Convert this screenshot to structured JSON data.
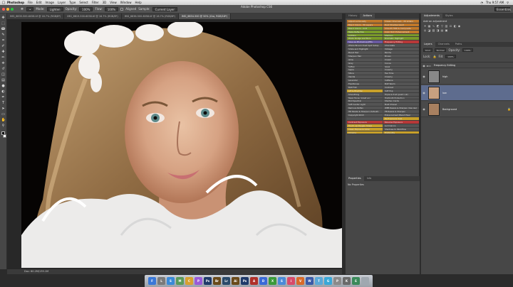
{
  "menubar": {
    "apple": "",
    "app": "Photoshop",
    "items": [
      "File",
      "Edit",
      "Image",
      "Layer",
      "Type",
      "Select",
      "Filter",
      "3D",
      "View",
      "Window",
      "Help"
    ],
    "clock": "Thu 9:57 AM"
  },
  "window_title": "Adobe Photoshop CS6",
  "options": {
    "mode_label": "Mode:",
    "mode_value": "Lighten",
    "opacity_label": "Opacity:",
    "opacity_value": "100%",
    "flow_label": "Flow:",
    "flow_value": "100%",
    "aligned_label": "Aligned",
    "sample_label": "Sample:",
    "sample_value": "Current Layer",
    "workspace": "Essentials"
  },
  "doc_tabs": [
    "IMG_6835-500-6058.tif @ 16.7% (RGB/8*)",
    "IMG_6819-500-6058.tif @ 16.7% (RGB/8*)",
    "IMG_6836-500-6058.tif @ 16.7% (RGB/8*)",
    "IMG_6834-500 @ 50% (Gra, RGB/16*)"
  ],
  "status": "Doc: 60.2M/139.1M",
  "actions_panel": {
    "tab_history": "History",
    "tab_actions": "Actions",
    "items_left": [
      {
        "label": "Adjust Luminosity",
        "color": "#c0782a"
      },
      {
        "label": "Blend Colors - 50 Layers",
        "color": "#c0782a"
      },
      {
        "label": "Blend Colors - Grid",
        "color": "#7a9a2a"
      },
      {
        "label": "Make Reflection",
        "color": "#7a9a2a"
      },
      {
        "label": "Lighten",
        "color": "#7a9a2a"
      },
      {
        "label": "Photo Dodge and Burn",
        "color": "#7a9a2a"
      },
      {
        "label": "Save as Photoshop JPEG",
        "color": "#6a5aa0"
      },
      {
        "label": "Whole Broom Dust Spot Setup",
        "color": "#545454"
      },
      {
        "label": "Smile and Highlight",
        "color": "#545454"
      },
      {
        "label": "Boost Hair",
        "color": "#545454"
      },
      {
        "label": "Sharpen Hair",
        "color": "#545454"
      },
      {
        "label": "Glow",
        "color": "#545454"
      },
      {
        "label": "Grey",
        "color": "#545454"
      },
      {
        "label": "Soften",
        "color": "#545454"
      },
      {
        "label": "Sepia",
        "color": "#545454"
      },
      {
        "label": "Shine",
        "color": "#545454"
      },
      {
        "label": "Vanilla",
        "color": "#545454"
      },
      {
        "label": "Lavender",
        "color": "#545454"
      },
      {
        "label": "Fleshtones",
        "color": "#545454"
      },
      {
        "label": "B/W Film",
        "color": "#545454"
      },
      {
        "label": "Lift & Brighten",
        "color": "#c8a02a"
      },
      {
        "label": "Smoothing",
        "color": "#545454"
      },
      {
        "label": "Mask Faces (great eo)",
        "color": "#545454"
      },
      {
        "label": "Bird Spectral",
        "color": "#545454"
      },
      {
        "label": "Soft Center Light",
        "color": "#545454"
      },
      {
        "label": "Remove Reflex",
        "color": "#545454"
      },
      {
        "label": "HR Resize & Sharpen (default)",
        "color": "#545454"
      },
      {
        "label": "Copyright 2013",
        "color": "#545454"
      },
      {
        "label": "",
        "color": "#545454"
      },
      {
        "label": "Contrast Exposure",
        "color": "#b83838"
      },
      {
        "label": "Touch up Oxygen Sharp",
        "color": "#c8a02a"
      },
      {
        "label": "Clean Exposure Glow",
        "color": "#c8a02a"
      },
      {
        "label": "Chroma",
        "color": "#c8a02a"
      }
    ],
    "items_right": [
      {
        "label": "Classic Channels - 20 sliders",
        "color": "#c0782a"
      },
      {
        "label": "Dark Shadow Good",
        "color": "#c0782a"
      },
      {
        "label": "Smooth HDR & Composite",
        "color": "#c0782a"
      },
      {
        "label": "Color Rich Enhancement",
        "color": "#c0782a"
      },
      {
        "label": "Sharpen",
        "color": "#7a9a2a"
      },
      {
        "label": "Dramatic Highlight",
        "color": "#7a9a2a"
      },
      {
        "label": "Frequency Editing",
        "color": "#b83838"
      },
      {
        "label": "Chocolate",
        "color": "#545454"
      },
      {
        "label": "Vintage",
        "color": "#545454"
      },
      {
        "label": "Mocha",
        "color": "#545454"
      },
      {
        "label": "Brown",
        "color": "#545454"
      },
      {
        "label": "Cream",
        "color": "#545454"
      },
      {
        "label": "Cocoa",
        "color": "#545454"
      },
      {
        "label": "Jewel",
        "color": "#545454"
      },
      {
        "label": "Creamy",
        "color": "#545454"
      },
      {
        "label": "Tea Time",
        "color": "#545454"
      },
      {
        "label": "Creamy",
        "color": "#545454"
      },
      {
        "label": "Caffeine",
        "color": "#545454"
      },
      {
        "label": "B/W Warm",
        "color": "#545454"
      },
      {
        "label": "Contrast",
        "color": "#545454"
      },
      {
        "label": "Soft Pop",
        "color": "#545454"
      },
      {
        "label": "Triple & fruit (paint cut)",
        "color": "#545454"
      },
      {
        "label": "Highlight Protection",
        "color": "#545454"
      },
      {
        "label": "Shorten Cords",
        "color": "#545454"
      },
      {
        "label": "Bust Chanel",
        "color": "#545454"
      },
      {
        "label": "WEB Resize & Sharpen (low res)",
        "color": "#545454"
      },
      {
        "label": "FB Resize & Sharpen",
        "color": "#545454"
      },
      {
        "label": "Enhancement Blend Pixel",
        "color": "#545454"
      },
      {
        "label": "Re Exposure Seal",
        "color": "#c8a02a"
      },
      {
        "label": "Reverse Exposure",
        "color": "#b83838"
      },
      {
        "label": "Luminance",
        "color": "#545454"
      },
      {
        "label": "Shadows to Workflow",
        "color": "#545454"
      },
      {
        "label": "Highlights",
        "color": "#c8a02a"
      }
    ]
  },
  "properties": {
    "tab_properties": "Properties",
    "tab_info": "Info",
    "title": "No Properties"
  },
  "right_panel": {
    "tab_adjustments": "Adjustments",
    "tab_styles": "Styles",
    "adj_title": "Add an adjustment",
    "tab_layers": "Layers",
    "tab_channels": "Channels",
    "tab_paths": "Paths",
    "kind_label": "Kind",
    "blend_mode": "Normal",
    "opacity_label": "Opacity:",
    "opacity_value": "100%",
    "lock_label": "Lock:",
    "fill_label": "Fill:",
    "fill_value": "100%",
    "group_name": "Frequency Editing",
    "layers": [
      {
        "name": "high",
        "thumb": "#808080",
        "selected": false
      },
      {
        "name": "low",
        "thumb": "#c8a080",
        "selected": true
      },
      {
        "name": "Background",
        "thumb": "#a88060",
        "selected": false
      }
    ]
  },
  "dock": {
    "icons": [
      {
        "label": "F",
        "color": "#3a78d8"
      },
      {
        "label": "L",
        "color": "#7a7a7a"
      },
      {
        "label": "S",
        "color": "#3a8ad8"
      },
      {
        "label": "M",
        "color": "#5a9a5a"
      },
      {
        "label": "C",
        "color": "#d8a030"
      },
      {
        "label": "P",
        "color": "#9a5ad8"
      },
      {
        "label": "Ps",
        "color": "#1f3a6a"
      },
      {
        "label": "Br",
        "color": "#6a4a1a"
      },
      {
        "label": "Lr",
        "color": "#2a4a6a"
      },
      {
        "label": "Ai",
        "color": "#6a4a1a"
      },
      {
        "label": "Ps",
        "color": "#1f3a6a"
      },
      {
        "label": "A",
        "color": "#b0302a"
      },
      {
        "label": "D",
        "color": "#3a6ad8"
      },
      {
        "label": "X",
        "color": "#3a9a3a"
      },
      {
        "label": "S",
        "color": "#4a8ad8"
      },
      {
        "label": "i",
        "color": "#d84a6a"
      },
      {
        "label": "V",
        "color": "#d86a2a"
      },
      {
        "label": "W",
        "color": "#3a5aa8"
      },
      {
        "label": "T",
        "color": "#5aa8d8"
      },
      {
        "label": "G",
        "color": "#3aa8d8"
      },
      {
        "label": "P",
        "color": "#8a8a8a"
      },
      {
        "label": "K",
        "color": "#6a6a6a"
      },
      {
        "label": "E",
        "color": "#3a8a5a"
      },
      {
        "label": "",
        "color": "#a0a8b0"
      }
    ]
  }
}
